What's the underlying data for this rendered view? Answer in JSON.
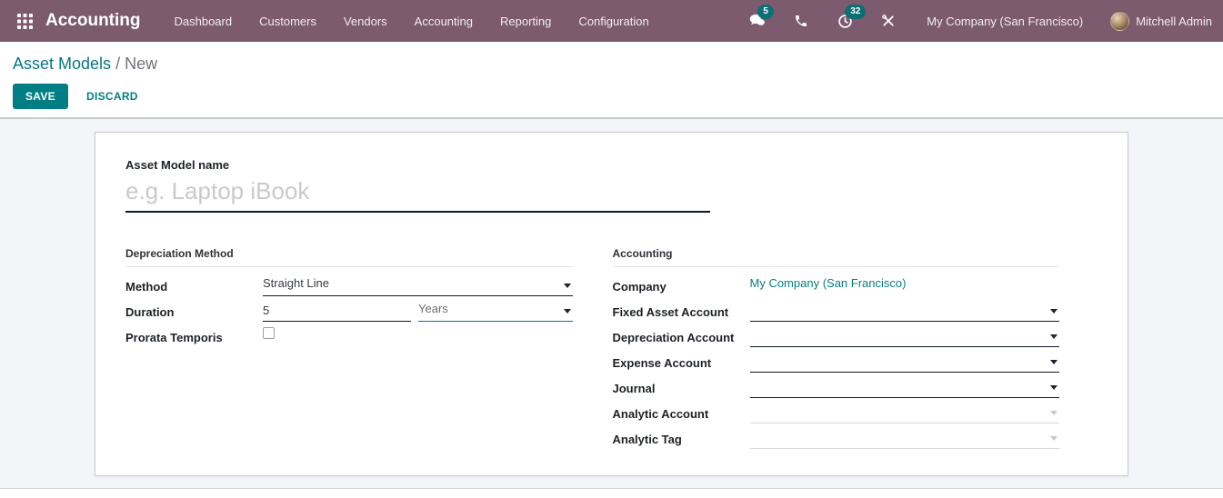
{
  "colors": {
    "navbar_bg": "#7d5b6f",
    "accent_teal": "#017e84",
    "badge_teal": "#0c6f75",
    "content_bg": "#f4f5f8"
  },
  "navbar": {
    "brand": "Accounting",
    "menu": {
      "dashboard": "Dashboard",
      "customers": "Customers",
      "vendors": "Vendors",
      "accounting": "Accounting",
      "reporting": "Reporting",
      "configuration": "Configuration"
    },
    "messages_badge": "5",
    "activities_badge": "32",
    "company": "My Company (San Francisco)",
    "user": "Mitchell Admin"
  },
  "control_panel": {
    "breadcrumb_parent": "Asset Models",
    "breadcrumb_separator": "/",
    "breadcrumb_current": "New",
    "save_label": "SAVE",
    "discard_label": "DISCARD"
  },
  "form": {
    "name_label": "Asset Model name",
    "name_placeholder": "e.g. Laptop iBook",
    "name_value": "",
    "depreciation": {
      "section_title": "Depreciation Method",
      "method_label": "Method",
      "method_value": "Straight Line",
      "duration_label": "Duration",
      "duration_value": "5",
      "duration_unit": "Years",
      "prorata_label": "Prorata Temporis",
      "prorata_checked": false
    },
    "accounting": {
      "section_title": "Accounting",
      "company_label": "Company",
      "company_value": "My Company (San Francisco)",
      "rows": [
        {
          "label": "Fixed Asset Account",
          "value": "",
          "disabled": false
        },
        {
          "label": "Depreciation Account",
          "value": "",
          "disabled": false
        },
        {
          "label": "Expense Account",
          "value": "",
          "disabled": false
        },
        {
          "label": "Journal",
          "value": "",
          "disabled": false
        },
        {
          "label": "Analytic Account",
          "value": "",
          "disabled": true
        },
        {
          "label": "Analytic Tag",
          "value": "",
          "disabled": true
        }
      ]
    }
  }
}
